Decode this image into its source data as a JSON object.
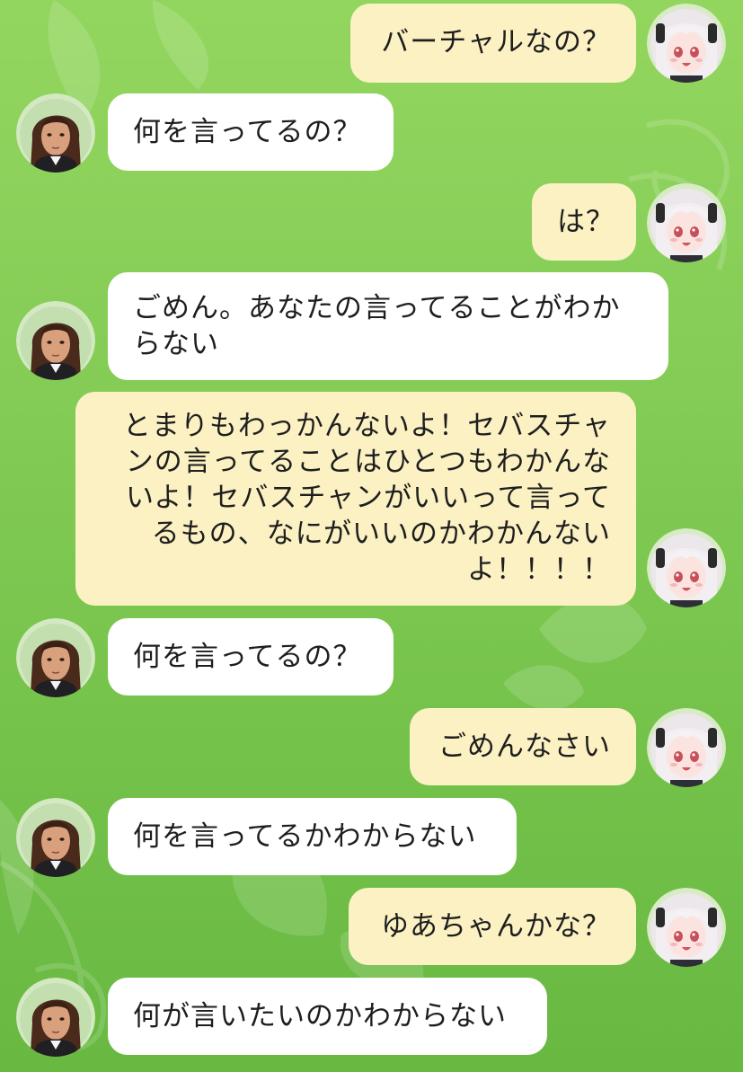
{
  "conversation": {
    "messages": [
      {
        "from": "me",
        "text": "バーチャルなの？"
      },
      {
        "from": "bot",
        "text": "何を言ってるの？"
      },
      {
        "from": "me",
        "text": "は？"
      },
      {
        "from": "bot",
        "text": "ごめん。あなたの言ってることがわか\nらない"
      },
      {
        "from": "me",
        "text": "とまりもわっかんないよ！セバスチャ\nンの言ってることはひとつもわかんな\nいよ！セバスチャンがいいって言って\nるもの、なにがいいのかわかんない\nよ！！！！"
      },
      {
        "from": "bot",
        "text": "何を言ってるの？"
      },
      {
        "from": "me",
        "text": "ごめんなさい"
      },
      {
        "from": "bot",
        "text": "何を言ってるかわからない"
      },
      {
        "from": "me",
        "text": "ゆあちゃんかな？"
      },
      {
        "from": "bot",
        "text": "何が言いたいのかわからない"
      }
    ]
  },
  "avatars": {
    "me": {
      "icon": "anime-girl-avatar-icon"
    },
    "bot": {
      "icon": "man-portrait-avatar-icon"
    }
  },
  "colors": {
    "background_top": "#93d65f",
    "background_bottom": "#68b842",
    "incoming_bubble": "#ffffff",
    "outgoing_bubble": "#fbf1c3",
    "text": "#1e1e1e"
  }
}
